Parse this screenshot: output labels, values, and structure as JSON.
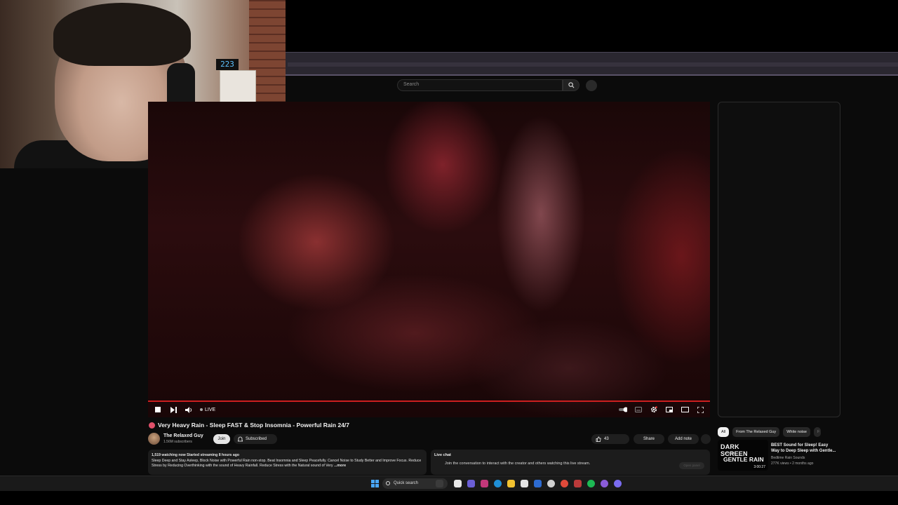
{
  "webcam": {
    "clock": "223"
  },
  "search": {
    "placeholder": "Search"
  },
  "video": {
    "live_label": "LIVE"
  },
  "title": "Very Heavy Rain - Sleep FAST & Stop Insomnia - Powerful Rain 24/7",
  "channel": {
    "name": "The Relaxed Guy",
    "subscribers": "1.56M subscribers",
    "join_label": "Join",
    "subscribed_label": "Subscribed"
  },
  "actions": {
    "like_count": "43",
    "share_label": "Share",
    "note_label": "Add note"
  },
  "description": {
    "meta": "1,519 watching now  Started streaming 8 hours ago",
    "text": "Sleep Deep and Stay Asleep, Block Noise with Powerful Rain non-stop. Beat Insomnia and Sleep Peacefully. Cancel Noise to Study Better and Improve Focus. Reduce Stress by Reducing Overthinking with the sound of Heavy Rainfall. Reduce Stress with the Natural sound of Very",
    "more": "...more"
  },
  "live_chat": {
    "header": "Live chat",
    "message": "Join the conversation to interact with the creator and others watching this live stream.",
    "open_label": "Open panel"
  },
  "chips": [
    "All",
    "From The Relaxed Guy",
    "White noise",
    "F"
  ],
  "recommended": {
    "thumb_line1": "DARK SCREEN",
    "thumb_line2": "Relaxing",
    "thumb_line3": "GENTLE RAIN",
    "duration": "3:00:27",
    "title": "BEST Sound for Sleep! Easy Way to Deep Sleep with Gentle...",
    "channel": "Bedtime Rain Sounds",
    "meta": "277K views • 2 months ago"
  },
  "taskbar": {
    "search_label": "Quick search"
  },
  "colors": {
    "accent_red": "#cc1f1f",
    "background": "#0b0b0b"
  }
}
